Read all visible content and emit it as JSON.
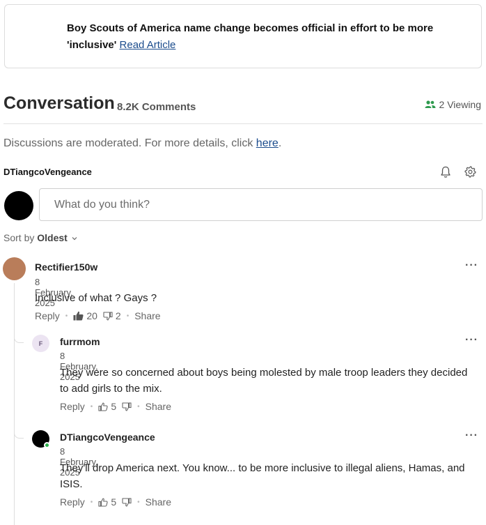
{
  "article": {
    "headline": "Boy Scouts of America name change becomes official in effort to be more 'inclusive'",
    "link_label": "Read Article"
  },
  "conversation": {
    "title": "Conversation",
    "comment_count": "8.2K Comments",
    "viewing": "2 Viewing"
  },
  "moderation": {
    "text": "Discussions are moderated. For more details, click ",
    "link": "here",
    "end": "."
  },
  "current_user": {
    "username": "DTiangcoVengeance"
  },
  "composer": {
    "placeholder": "What do you think?"
  },
  "sort": {
    "prefix": "Sort by",
    "value": "Oldest"
  },
  "colors": {
    "accent": "#1a4b8c",
    "viewing_icon": "#2e9a4e",
    "online_dot": "#2bb24c"
  },
  "comments": [
    {
      "username": "Rectifier150w",
      "date": "8 February, 2025",
      "text": "Inclusive of what ? Gays ?",
      "reply": "Reply",
      "likes": "20",
      "dislikes": "2",
      "share": "Share",
      "avatar_color": "#b97d5a"
    },
    {
      "username": "furrmom",
      "avatar_letter": "F",
      "date": "8 February, 2025",
      "text": "They were so concerned about boys being molested by male troop leaders they decided to add girls to the mix.",
      "reply": "Reply",
      "likes": "5",
      "share": "Share",
      "avatar_color": "#ece4f2"
    },
    {
      "username": "DTiangcoVengeance",
      "date": "8 February, 2025",
      "text": "They'll drop America next. You know... to be more inclusive to illegal aliens, Hamas, and ISIS.",
      "reply": "Reply",
      "likes": "5",
      "share": "Share",
      "avatar_color": "#000000"
    }
  ]
}
